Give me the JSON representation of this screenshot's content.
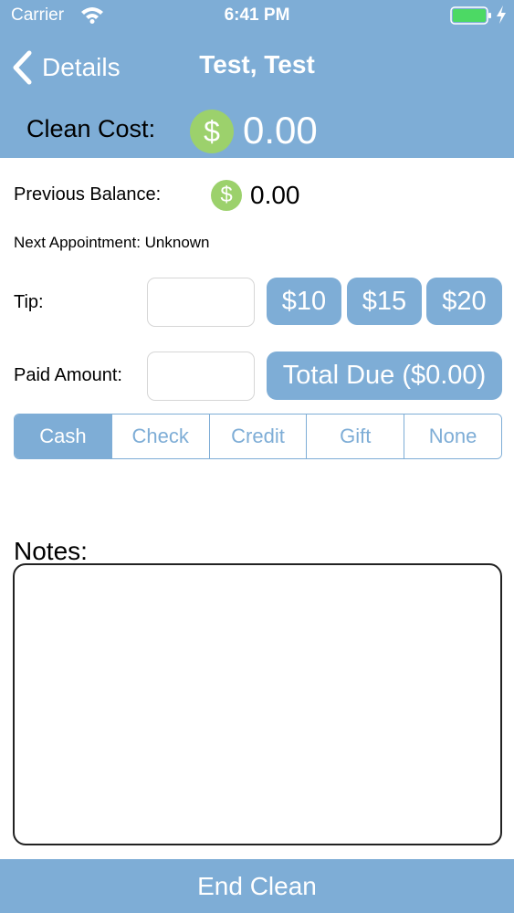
{
  "status_bar": {
    "carrier": "Carrier",
    "time": "6:41 PM",
    "battery_color": "#4cd964"
  },
  "nav": {
    "back_label": "Details",
    "title": "Test, Test"
  },
  "clean_cost": {
    "label": "Clean Cost:",
    "currency_symbol": "$",
    "value": "0.00"
  },
  "previous_balance": {
    "label": "Previous Balance:",
    "currency_symbol": "$",
    "value": "0.00"
  },
  "next_appointment": "Next Appointment: Unknown",
  "tip": {
    "label": "Tip:",
    "value": "",
    "presets": [
      "$10",
      "$15",
      "$20"
    ]
  },
  "paid": {
    "label": "Paid Amount:",
    "value": "",
    "total_due_label": "Total Due ($0.00)"
  },
  "payment_methods": {
    "options": [
      "Cash",
      "Check",
      "Credit",
      "Gift",
      "None"
    ],
    "selected": "Cash"
  },
  "notes": {
    "label": "Notes:",
    "value": ""
  },
  "end_clean_label": "End Clean",
  "colors": {
    "accent": "#7eadd6",
    "money_badge": "#9cd16c"
  },
  "icons": [
    "wifi-icon",
    "battery-icon",
    "charging-icon",
    "back-chevron-icon",
    "dollar-icon"
  ]
}
